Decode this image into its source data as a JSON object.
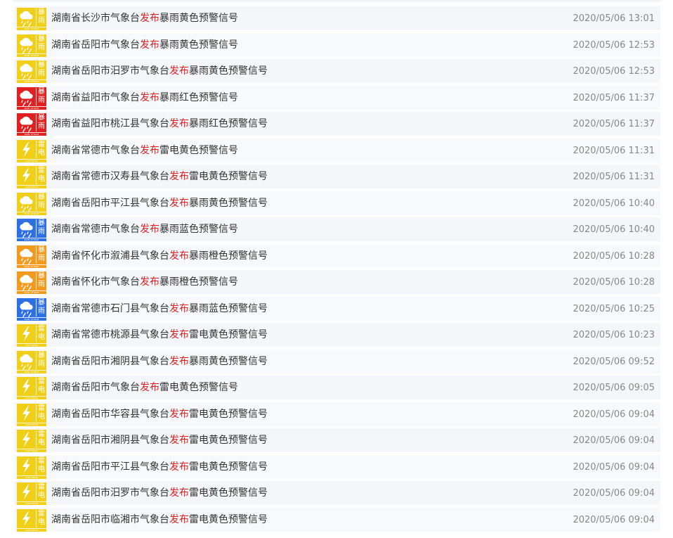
{
  "colors": {
    "yellow": "#f1cf16",
    "red": "#e02020",
    "orange": "#f39a1c",
    "blue": "#2d6fe5",
    "title_text": "#333333",
    "time_text": "#888888",
    "row_bg": "#f5f6fa"
  },
  "icons": {
    "rainstorm": {
      "icon_name": "rainstorm-warning-icon",
      "glyph_top": "暴",
      "glyph_bottom": "雨",
      "caption": "RAIN STORM"
    },
    "thunder": {
      "icon_name": "lightning-warning-icon",
      "glyph_top": "雷",
      "glyph_bottom": "电",
      "caption": "LIGHTNING"
    }
  },
  "warnings": [
    {
      "prefix": "湖南省长沙市气象台",
      "verb": "发布",
      "suffix": "暴雨黄色预警信号",
      "time": "2020/05/06 13:01",
      "type": "rainstorm",
      "level": "yellow"
    },
    {
      "prefix": "湖南省岳阳市气象台",
      "verb": "发布",
      "suffix": "暴雨黄色预警信号",
      "time": "2020/05/06 12:53",
      "type": "rainstorm",
      "level": "yellow"
    },
    {
      "prefix": "湖南省岳阳市汨罗市气象台",
      "verb": "发布",
      "suffix": "暴雨黄色预警信号",
      "time": "2020/05/06 12:53",
      "type": "rainstorm",
      "level": "yellow"
    },
    {
      "prefix": "湖南省益阳市气象台",
      "verb": "发布",
      "suffix": "暴雨红色预警信号",
      "time": "2020/05/06 11:37",
      "type": "rainstorm",
      "level": "red"
    },
    {
      "prefix": "湖南省益阳市桃江县气象台",
      "verb": "发布",
      "suffix": "暴雨红色预警信号",
      "time": "2020/05/06 11:37",
      "type": "rainstorm",
      "level": "red"
    },
    {
      "prefix": "湖南省常德市气象台",
      "verb": "发布",
      "suffix": "雷电黄色预警信号",
      "time": "2020/05/06 11:31",
      "type": "thunder",
      "level": "yellow"
    },
    {
      "prefix": "湖南省常德市汉寿县气象台",
      "verb": "发布",
      "suffix": "雷电黄色预警信号",
      "time": "2020/05/06 11:31",
      "type": "thunder",
      "level": "yellow"
    },
    {
      "prefix": "湖南省岳阳市平江县气象台",
      "verb": "发布",
      "suffix": "暴雨黄色预警信号",
      "time": "2020/05/06 10:40",
      "type": "rainstorm",
      "level": "yellow"
    },
    {
      "prefix": "湖南省常德市气象台",
      "verb": "发布",
      "suffix": "暴雨蓝色预警信号",
      "time": "2020/05/06 10:40",
      "type": "rainstorm",
      "level": "blue"
    },
    {
      "prefix": "湖南省怀化市溆浦县气象台",
      "verb": "发布",
      "suffix": "暴雨橙色预警信号",
      "time": "2020/05/06 10:28",
      "type": "rainstorm",
      "level": "orange"
    },
    {
      "prefix": "湖南省怀化市气象台",
      "verb": "发布",
      "suffix": "暴雨橙色预警信号",
      "time": "2020/05/06 10:28",
      "type": "rainstorm",
      "level": "orange"
    },
    {
      "prefix": "湖南省常德市石门县气象台",
      "verb": "发布",
      "suffix": "暴雨蓝色预警信号",
      "time": "2020/05/06 10:25",
      "type": "rainstorm",
      "level": "blue"
    },
    {
      "prefix": "湖南省常德市桃源县气象台",
      "verb": "发布",
      "suffix": "雷电黄色预警信号",
      "time": "2020/05/06 10:23",
      "type": "thunder",
      "level": "yellow"
    },
    {
      "prefix": "湖南省岳阳市湘阴县气象台",
      "verb": "发布",
      "suffix": "暴雨黄色预警信号",
      "time": "2020/05/06 09:52",
      "type": "rainstorm",
      "level": "yellow"
    },
    {
      "prefix": "湖南省岳阳市气象台",
      "verb": "发布",
      "suffix": "雷电黄色预警信号",
      "time": "2020/05/06 09:05",
      "type": "thunder",
      "level": "yellow"
    },
    {
      "prefix": "湖南省岳阳市华容县气象台",
      "verb": "发布",
      "suffix": "雷电黄色预警信号",
      "time": "2020/05/06 09:04",
      "type": "thunder",
      "level": "yellow"
    },
    {
      "prefix": "湖南省岳阳市湘阴县气象台",
      "verb": "发布",
      "suffix": "雷电黄色预警信号",
      "time": "2020/05/06 09:04",
      "type": "thunder",
      "level": "yellow"
    },
    {
      "prefix": "湖南省岳阳市平江县气象台",
      "verb": "发布",
      "suffix": "雷电黄色预警信号",
      "time": "2020/05/06 09:04",
      "type": "thunder",
      "level": "yellow"
    },
    {
      "prefix": "湖南省岳阳市汨罗市气象台",
      "verb": "发布",
      "suffix": "雷电黄色预警信号",
      "time": "2020/05/06 09:04",
      "type": "thunder",
      "level": "yellow"
    },
    {
      "prefix": "湖南省岳阳市临湘市气象台",
      "verb": "发布",
      "suffix": "雷电黄色预警信号",
      "time": "2020/05/06 09:04",
      "type": "thunder",
      "level": "yellow"
    }
  ]
}
